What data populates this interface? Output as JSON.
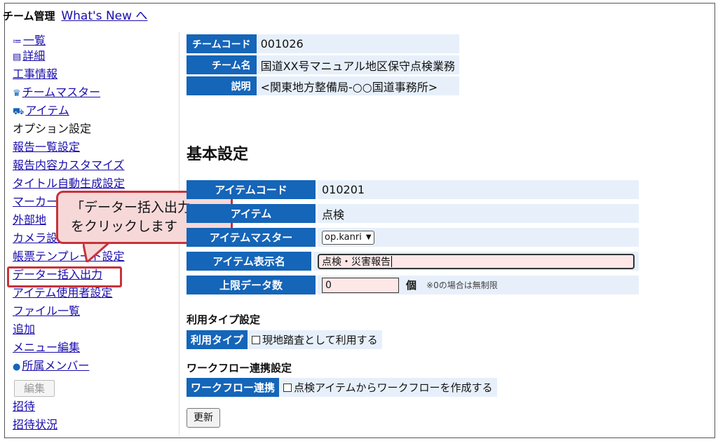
{
  "header": {
    "team_label": "チーム管理",
    "whats_new": "What's New へ"
  },
  "sidebar": {
    "items": [
      {
        "label": "一覧",
        "icon": "≔"
      },
      {
        "label": "詳細",
        "icon": "▤"
      },
      {
        "label": "工事情報"
      },
      {
        "label": "チームマスター",
        "icon": "♛"
      },
      {
        "label": "アイテム",
        "icon": "⛟"
      },
      {
        "label": "オプション設定"
      },
      {
        "label": "報告一覧設定"
      },
      {
        "label": "報告内容カスタマイズ"
      },
      {
        "label": "タイトル自動生成設定"
      },
      {
        "label": "マーカー"
      },
      {
        "label": "外部地"
      },
      {
        "label": "カメラ設定"
      },
      {
        "label": "帳票テンプレート設定"
      },
      {
        "label": "データー括入出力"
      },
      {
        "label": "アイテム使用者設定"
      },
      {
        "label": "ファイル一覧"
      },
      {
        "label": "追加"
      },
      {
        "label": "メニュー編集"
      },
      {
        "label": "所属メンバー",
        "icon": "●"
      },
      {
        "label": "招待"
      },
      {
        "label": "招待状況"
      }
    ],
    "edit_button": "編集"
  },
  "callout": {
    "line1": "「データー括入出力」",
    "line2": "をクリックします"
  },
  "team": {
    "code_label": "チームコード",
    "code": "001026",
    "name_label": "チーム名",
    "name": "国道XX号マニュアル地区保守点検業務",
    "desc_label": "説明",
    "desc": "<関東地方整備局-○○国道事務所>"
  },
  "basic": {
    "heading": "基本設定",
    "item_code_label": "アイテムコード",
    "item_code": "010201",
    "item_label": "アイテム",
    "item": "点検",
    "master_label": "アイテムマスター",
    "master_value": "op.kanri",
    "display_name_label": "アイテム表示名",
    "display_name": "点検・災害報告",
    "limit_label": "上限データ数",
    "limit": "0",
    "limit_unit": "個",
    "limit_note": "※0の場合は無制限"
  },
  "usage": {
    "heading": "利用タイプ設定",
    "label": "利用タイプ",
    "option": "現地踏査として利用する"
  },
  "workflow": {
    "heading": "ワークフロー連携設定",
    "label": "ワークフロー連携",
    "option": "点検アイテムからワークフローを作成する"
  },
  "update_button": "更新",
  "colors": {
    "label_bg": "#1565b8",
    "value_bg": "#e7f0fa",
    "highlight": "#c8323a",
    "callout_bg": "#f7d8d8"
  }
}
